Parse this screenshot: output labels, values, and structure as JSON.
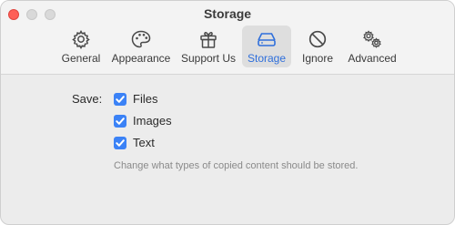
{
  "window": {
    "title": "Storage"
  },
  "tabs": [
    {
      "label": "General",
      "icon": "gear-icon",
      "active": false
    },
    {
      "label": "Appearance",
      "icon": "palette-icon",
      "active": false
    },
    {
      "label": "Support Us",
      "icon": "gift-icon",
      "active": false
    },
    {
      "label": "Storage",
      "icon": "drive-icon",
      "active": true
    },
    {
      "label": "Ignore",
      "icon": "prohibited-icon",
      "active": false
    },
    {
      "label": "Advanced",
      "icon": "gears-icon",
      "active": false
    }
  ],
  "storage": {
    "save_label": "Save:",
    "options": [
      {
        "label": "Files",
        "checked": true
      },
      {
        "label": "Images",
        "checked": true
      },
      {
        "label": "Text",
        "checked": true
      }
    ],
    "hint": "Change what types of copied content should be stored."
  },
  "colors": {
    "accent": "#3b82f6",
    "active_tab_text": "#2f6fdb",
    "close_button": "#fe5f57"
  }
}
